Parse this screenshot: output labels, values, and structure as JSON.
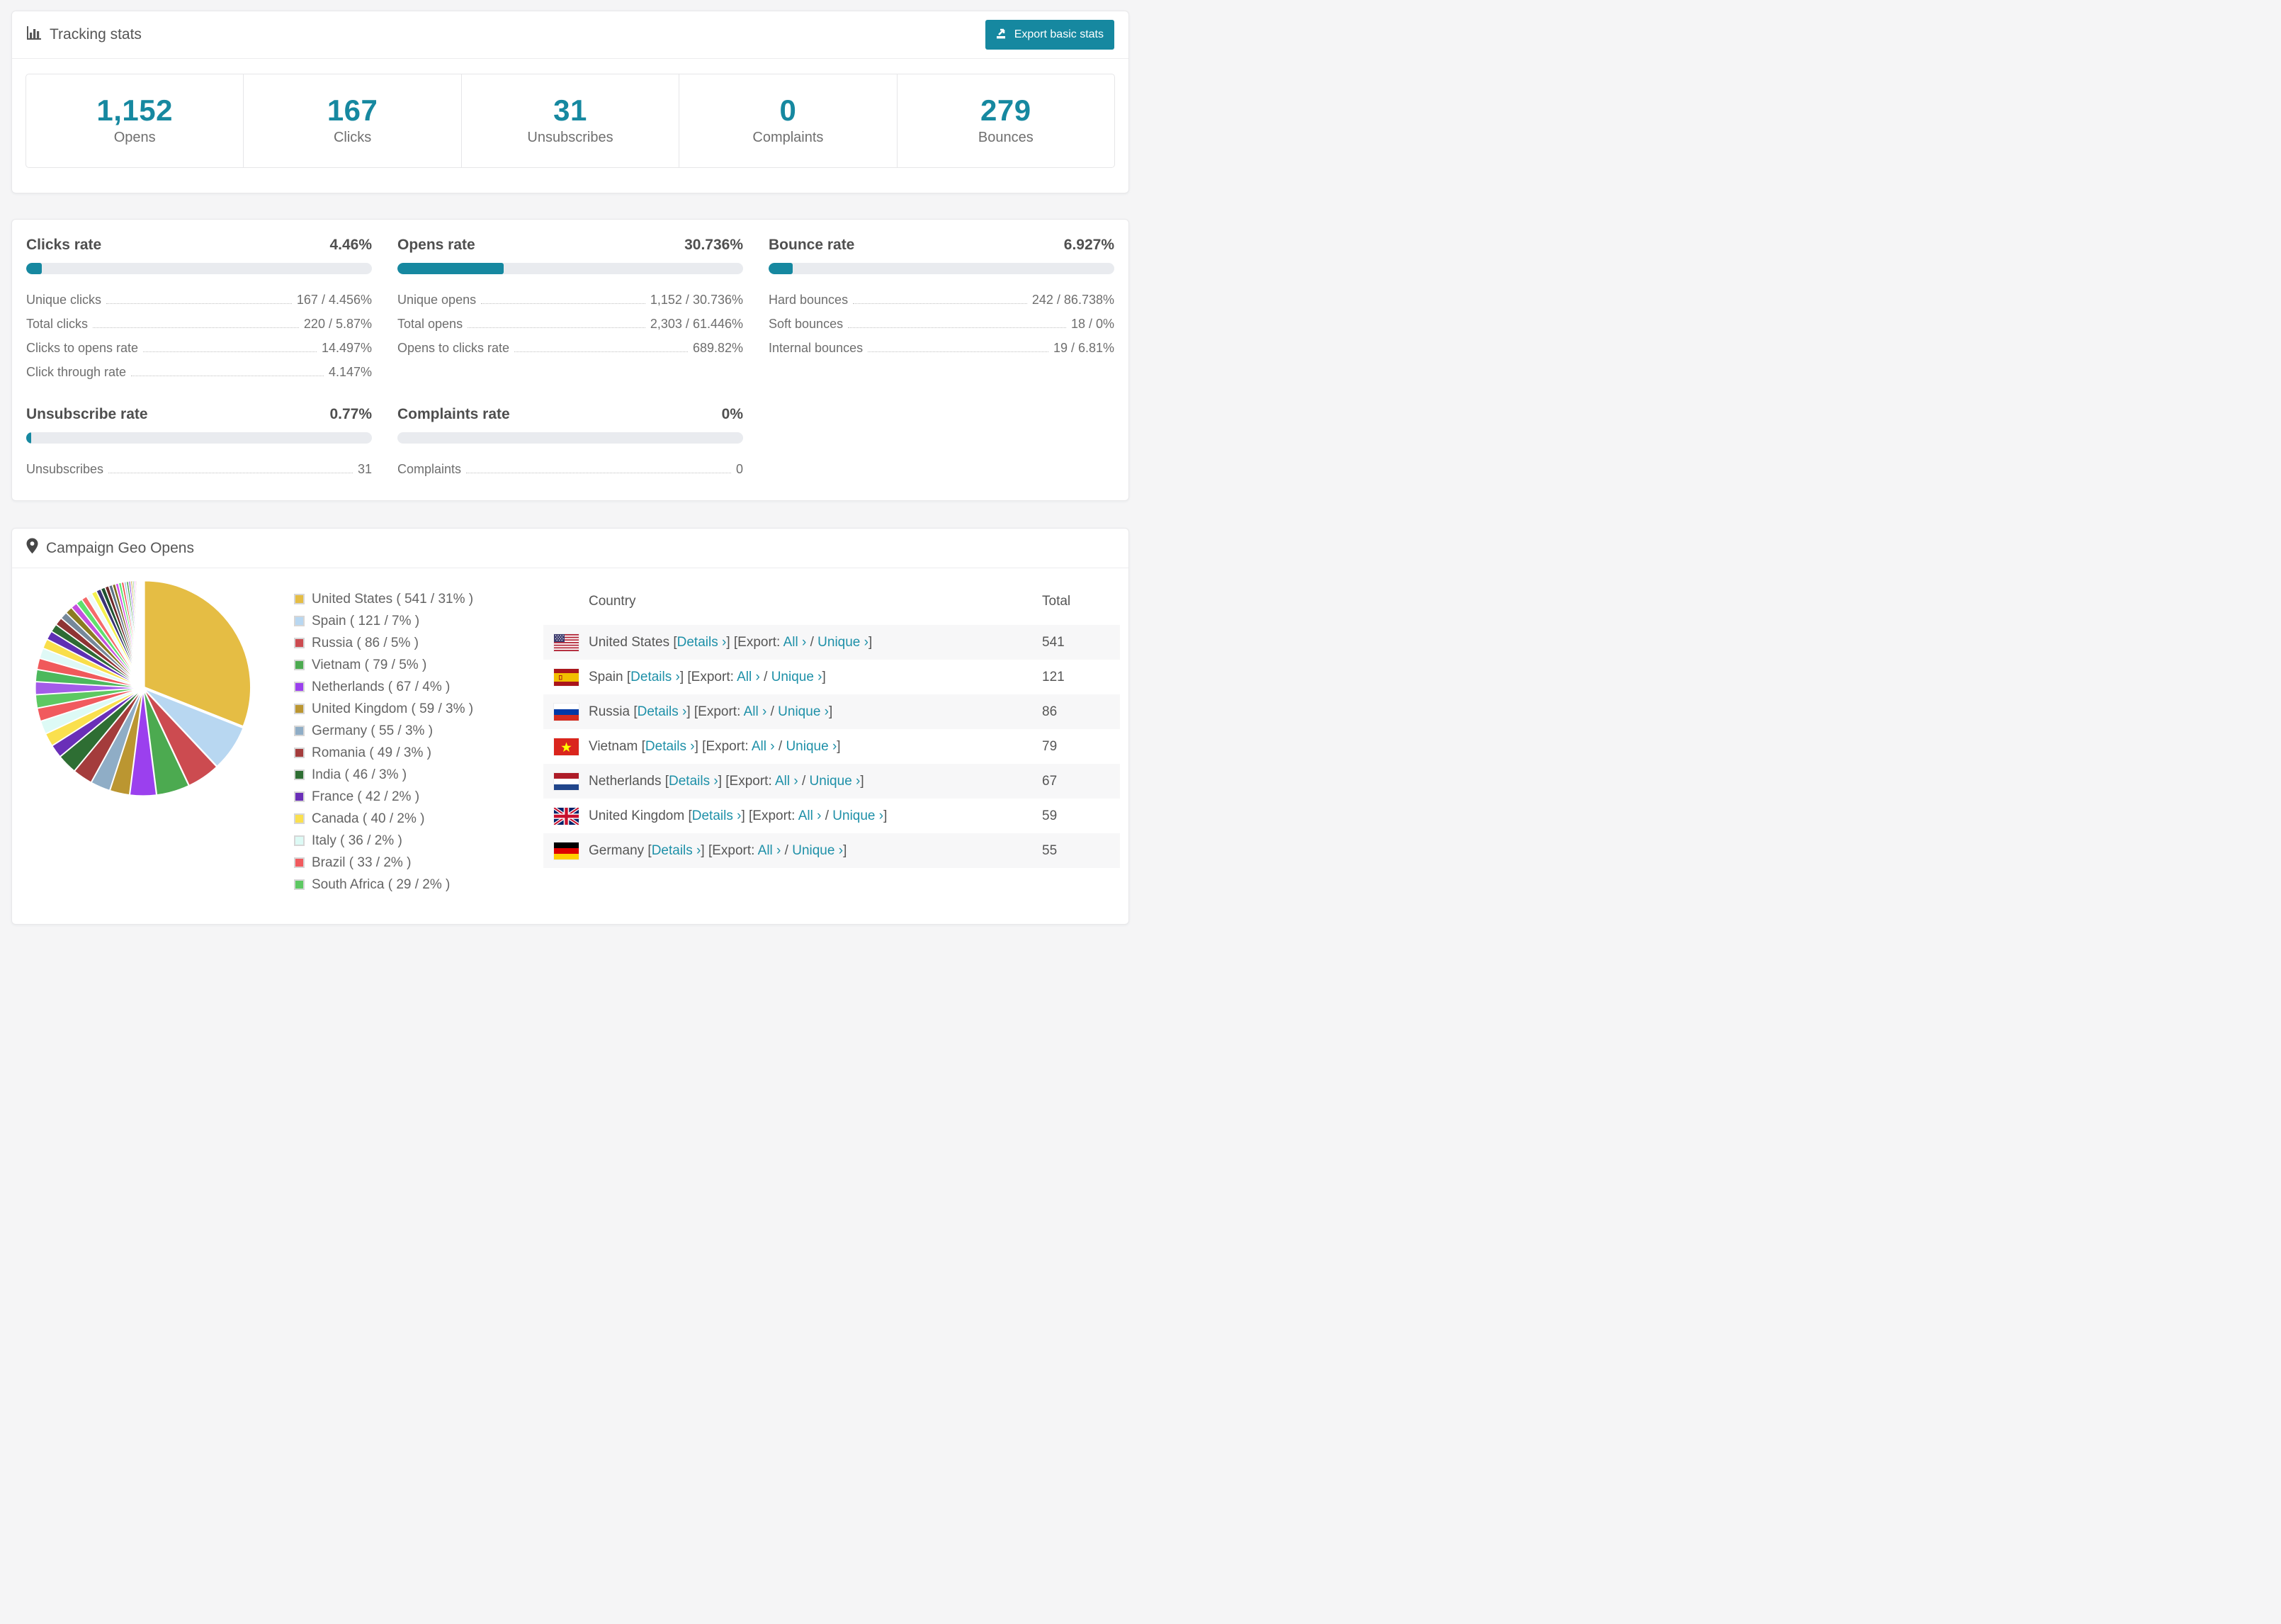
{
  "colors": {
    "accent": "#1688a0",
    "page_bg": "#f5f5f6",
    "progress_track": "#e9ebef",
    "link": "#1e90a8"
  },
  "header_card": {
    "title": "Tracking stats",
    "title_icon": "bar-chart-icon",
    "export_label": "Export basic stats",
    "export_icon": "export-icon"
  },
  "stats": [
    {
      "value": "1,152",
      "label": "Opens"
    },
    {
      "value": "167",
      "label": "Clicks"
    },
    {
      "value": "31",
      "label": "Unsubscribes"
    },
    {
      "value": "0",
      "label": "Complaints"
    },
    {
      "value": "279",
      "label": "Bounces"
    }
  ],
  "rates": [
    {
      "title": "Clicks rate",
      "value": "4.46%",
      "percent": 4.46,
      "rows": [
        {
          "label": "Unique clicks",
          "value": "167 / 4.456%"
        },
        {
          "label": "Total clicks",
          "value": "220 / 5.87%"
        },
        {
          "label": "Clicks to opens rate",
          "value": "14.497%"
        },
        {
          "label": "Click through rate",
          "value": "4.147%"
        }
      ]
    },
    {
      "title": "Opens rate",
      "value": "30.736%",
      "percent": 30.736,
      "rows": [
        {
          "label": "Unique opens",
          "value": "1,152 / 30.736%"
        },
        {
          "label": "Total opens",
          "value": "2,303 / 61.446%"
        },
        {
          "label": "Opens to clicks rate",
          "value": "689.82%"
        }
      ]
    },
    {
      "title": "Bounce rate",
      "value": "6.927%",
      "percent": 6.927,
      "rows": [
        {
          "label": "Hard bounces",
          "value": "242 / 86.738%"
        },
        {
          "label": "Soft bounces",
          "value": "18 / 0%"
        },
        {
          "label": "Internal bounces",
          "value": "19 / 6.81%"
        }
      ]
    },
    {
      "title": "Unsubscribe rate",
      "value": "0.77%",
      "percent": 0.77,
      "rows": [
        {
          "label": "Unsubscribes",
          "value": "31"
        }
      ]
    },
    {
      "title": "Complaints rate",
      "value": "0%",
      "percent": 0,
      "rows": [
        {
          "label": "Complaints",
          "value": "0"
        }
      ]
    }
  ],
  "geo": {
    "title": "Campaign Geo Opens",
    "title_icon": "map-pin-icon",
    "chart_data": {
      "type": "pie",
      "title": "Campaign Geo Opens",
      "legend_position": "right",
      "start_angle_deg": 0,
      "direction": "clockwise",
      "series": [
        {
          "label": "United States",
          "value": 541,
          "percent": 31,
          "color": "#e5bd44"
        },
        {
          "label": "Spain",
          "value": 121,
          "percent": 7,
          "color": "#b8d7f1"
        },
        {
          "label": "Russia",
          "value": 86,
          "percent": 5,
          "color": "#cc4b50"
        },
        {
          "label": "Vietnam",
          "value": 79,
          "percent": 5,
          "color": "#4caa50"
        },
        {
          "label": "Netherlands",
          "value": 67,
          "percent": 4,
          "color": "#9b40ee"
        },
        {
          "label": "United Kingdom",
          "value": 59,
          "percent": 3,
          "color": "#bb9631"
        },
        {
          "label": "Germany",
          "value": 55,
          "percent": 3,
          "color": "#8fadc6"
        },
        {
          "label": "Romania",
          "value": 49,
          "percent": 3,
          "color": "#a43c3c"
        },
        {
          "label": "India",
          "value": 46,
          "percent": 3,
          "color": "#2e6e33"
        },
        {
          "label": "France",
          "value": 42,
          "percent": 2,
          "color": "#6a2fb8"
        },
        {
          "label": "Canada",
          "value": 40,
          "percent": 2,
          "color": "#fae04e"
        },
        {
          "label": "Italy",
          "value": 36,
          "percent": 2,
          "color": "#ddfaf5"
        },
        {
          "label": "Brazil",
          "value": 33,
          "percent": 2,
          "color": "#f15a5e"
        },
        {
          "label": "South Africa",
          "value": 29,
          "percent": 2,
          "color": "#5dc862"
        }
      ],
      "others_unlabeled_small_slices": {
        "total_percent": 26,
        "weights": [
          1.6,
          1.5,
          1.4,
          1.3,
          1.2,
          1.1,
          1.0,
          1.0,
          0.9,
          0.9,
          0.8,
          0.8,
          0.7,
          0.7,
          0.65,
          0.6,
          0.55,
          0.5,
          0.45,
          0.4,
          0.38,
          0.35,
          0.32,
          0.3,
          0.28,
          0.25,
          0.22,
          0.2,
          0.18,
          0.16,
          0.14,
          0.12,
          0.1,
          0.09,
          0.08,
          0.07,
          0.06,
          0.05,
          0.04,
          0.03
        ],
        "palette": [
          "#a35ce8",
          "#4cb85c",
          "#f0595b",
          "#dff9f6",
          "#f9de4a",
          "#5e2fb4",
          "#2e6b34",
          "#8f3434",
          "#76889a",
          "#8c7b22",
          "#c44fe0",
          "#5fe06e",
          "#f56a6a",
          "#effbfb",
          "#f5f14e",
          "#3a3274",
          "#1f5130",
          "#6e2828",
          "#5c7083",
          "#7c6c1c",
          "#d44fe8",
          "#57e86e",
          "#ef5350",
          "#a9cbe8",
          "#43a047",
          "#8e4fe0",
          "#c9a227",
          "#66bb6a",
          "#e84ef0",
          "#b5912c"
        ]
      }
    },
    "table": {
      "columns": [
        "Country",
        "Total"
      ],
      "link_labels": {
        "details": "Details ›",
        "export_prefix": "[Export:",
        "all": "All ›",
        "separator": "/",
        "unique": "Unique ›",
        "close_bracket": "]"
      },
      "rows": [
        {
          "country": "United States",
          "flag": "us",
          "total": "541"
        },
        {
          "country": "Spain",
          "flag": "es",
          "total": "121"
        },
        {
          "country": "Russia",
          "flag": "ru",
          "total": "86"
        },
        {
          "country": "Vietnam",
          "flag": "vn",
          "total": "79"
        },
        {
          "country": "Netherlands",
          "flag": "nl",
          "total": "67"
        },
        {
          "country": "United Kingdom",
          "flag": "gb",
          "total": "59"
        },
        {
          "country": "Germany",
          "flag": "de",
          "total": "55"
        }
      ]
    }
  }
}
